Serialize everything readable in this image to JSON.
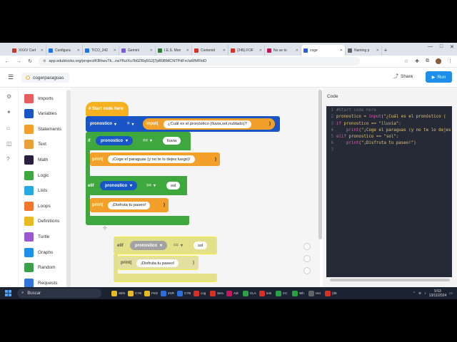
{
  "browser": {
    "tabs": [
      {
        "label": "XXXV Cert",
        "color": "#c0392b"
      },
      {
        "label": "Configura",
        "color": "#1a73e8"
      },
      {
        "label": "TICO_242",
        "color": "#1a73e8"
      },
      {
        "label": "Gemini",
        "color": "#7b5cd6"
      },
      {
        "label": "I.E.S. Mon",
        "color": "#2f7d32"
      },
      {
        "label": "Contenid",
        "color": "#d93025"
      },
      {
        "label": "(245) FOF",
        "color": "#d93025"
      },
      {
        "label": "No se to",
        "color": "#c2185b"
      },
      {
        "label": "coge",
        "color": "#2b5fd9",
        "active": true
      },
      {
        "label": "Naming p",
        "color": "#5f6368"
      }
    ],
    "new_tab_symbol": "+",
    "url": "app.edublocks.org/project/KBhwuTk...naYflu/Xu7b0ZRq5G2j7pB0BMCNTPdFrcIaWMFktD",
    "window_controls": [
      "—",
      "□",
      "✕"
    ]
  },
  "app": {
    "project_name": "cogerparaguas",
    "share_label": "Share",
    "run_label": "Run"
  },
  "toolbox": {
    "categories": [
      {
        "label": "Imports",
        "color": "#e85d5d"
      },
      {
        "label": "Variables",
        "color": "#1a55c5"
      },
      {
        "label": "Statements",
        "color": "#f2a02a"
      },
      {
        "label": "Text",
        "color": "#e9a03b"
      },
      {
        "label": "Math",
        "color": "#2b1f3f"
      },
      {
        "label": "Logic",
        "color": "#3ea73e"
      },
      {
        "label": "Lists",
        "color": "#29a9e1"
      },
      {
        "label": "Loops",
        "color": "#f0772b"
      },
      {
        "label": "Definitions",
        "color": "#e7b922"
      },
      {
        "label": "Turtle",
        "color": "#9b59d0"
      },
      {
        "label": "Graphs",
        "color": "#1e8fe8"
      },
      {
        "label": "Random",
        "color": "#3aa14a"
      },
      {
        "label": "Requests",
        "color": "#3273dc"
      }
    ]
  },
  "blocks": {
    "hat": "# Start code here",
    "assign_var": "pronostico",
    "assign_op": "=",
    "input_label": "input(",
    "input_text": "¿Cuál es el pronóstico (lluvia,sol,nublado)?",
    "close_paren": ")",
    "if_label": "if",
    "if_var": "pronostico",
    "if_op": "==",
    "if_value": "lluvia",
    "print_label": "print(",
    "print1_text": "¡Coge el paraguas (y no te lo dejes luego)!",
    "elif_label": "elif",
    "elif_var": "pronostico",
    "elif_op": "==",
    "elif_value": "sol",
    "print2_text": "¡Disfruta tu paseo!",
    "drag_elif_label": "elif",
    "drag_var": "pronostico",
    "drag_op": "==",
    "drag_value": "sol",
    "drag_print_label": "print(",
    "drag_print_text": "¡Disfruta tu paseo!"
  },
  "code_panel": {
    "tab_label": "Code",
    "lines": [
      {
        "n": "1",
        "segments": [
          {
            "t": "#Start code here",
            "c": "#6d7180"
          }
        ]
      },
      {
        "n": "2",
        "segments": [
          {
            "t": "pronostico = ",
            "c": "#e8c56d"
          },
          {
            "t": "input",
            "c": "#e05fb3"
          },
          {
            "t": "(\"¿Cuál es el pronóstico (",
            "c": "#e8c56d"
          }
        ]
      },
      {
        "n": "3",
        "segments": [
          {
            "t": "if ",
            "c": "#e05fb3"
          },
          {
            "t": "pronostico == ",
            "c": "#e8c56d"
          },
          {
            "t": "\"lluvia\"",
            "c": "#e8c56d"
          },
          {
            "t": ":",
            "c": "#e8c56d"
          }
        ]
      },
      {
        "n": "4",
        "segments": [
          {
            "t": "    ",
            "c": "#e8c56d"
          },
          {
            "t": "print",
            "c": "#e05fb3"
          },
          {
            "t": "(\"¡Coge el paraguas (y no te lo dejes",
            "c": "#e8c56d"
          }
        ]
      },
      {
        "n": "5",
        "segments": [
          {
            "t": "elif ",
            "c": "#e05fb3"
          },
          {
            "t": "pronostico == ",
            "c": "#e8c56d"
          },
          {
            "t": "\"sol\"",
            "c": "#e8c56d"
          },
          {
            "t": ":",
            "c": "#e8c56d"
          }
        ]
      },
      {
        "n": "6",
        "segments": [
          {
            "t": "    ",
            "c": "#e8c56d"
          },
          {
            "t": "print",
            "c": "#e05fb3"
          },
          {
            "t": "(\"¡Disfruta tu paseo!\")",
            "c": "#e8c56d"
          }
        ]
      },
      {
        "n": "7",
        "segments": [
          {
            "t": "",
            "c": "#e8c56d"
          }
        ]
      }
    ]
  },
  "taskbar": {
    "search_placeholder": "Buscar",
    "apps": [
      {
        "label": "SEN",
        "color": "#e7b922"
      },
      {
        "label": "CYB",
        "color": "#e7b922"
      },
      {
        "label": "FKD",
        "color": "#e7b922"
      },
      {
        "label": "ZSR",
        "color": "#2b6fdc"
      },
      {
        "label": "CYB",
        "color": "#2b6fdc"
      },
      {
        "label": "cog",
        "color": "#d93025"
      },
      {
        "label": "Serv",
        "color": "#d93025"
      },
      {
        "label": "Adr",
        "color": "#c2185b"
      },
      {
        "label": "CLA",
        "color": "#2e9e47"
      },
      {
        "label": "tele",
        "color": "#d93025"
      },
      {
        "label": "CC",
        "color": "#2e9e47"
      },
      {
        "label": "Wh",
        "color": "#25a244"
      },
      {
        "label": "Her",
        "color": "#5f6368"
      },
      {
        "label": "(35",
        "color": "#d93025"
      }
    ],
    "time": "9:53",
    "date": "13/11/2024"
  }
}
